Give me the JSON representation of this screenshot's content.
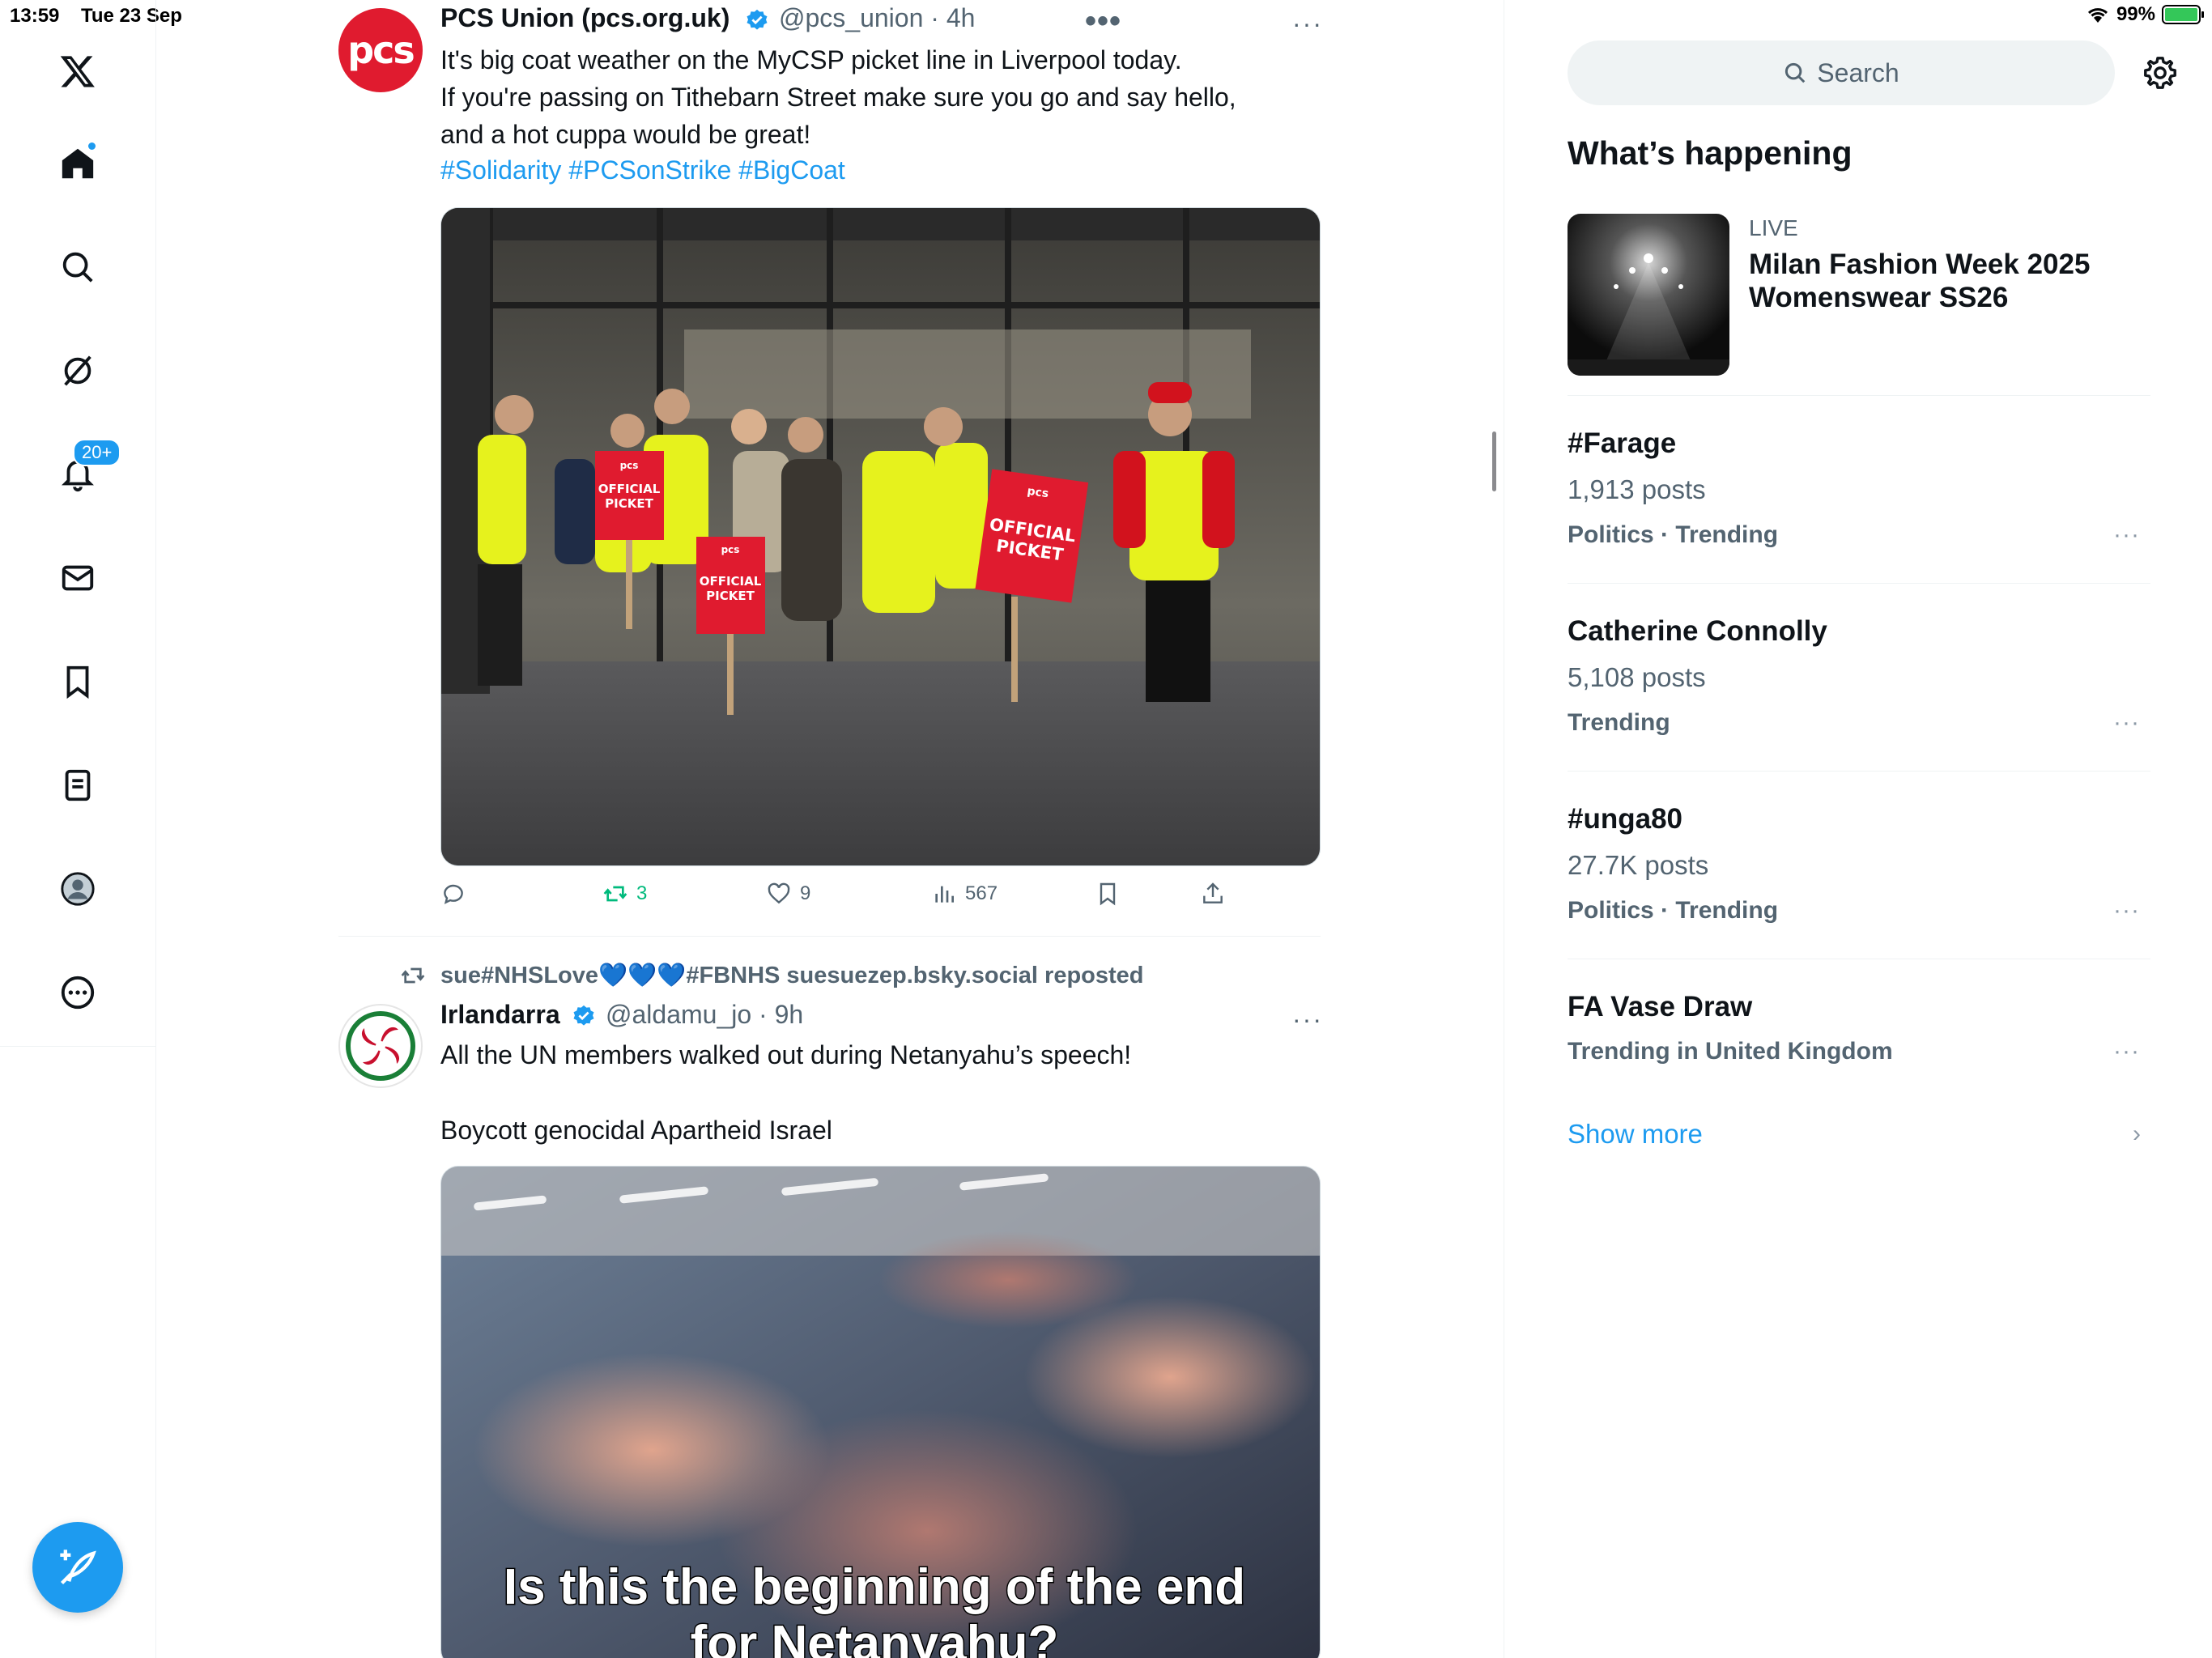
{
  "status_bar": {
    "time": "13:59",
    "date": "Tue 23 Sep",
    "battery": "99%"
  },
  "sidebar": {
    "notification_badge": "20+",
    "items": [
      "home",
      "explore",
      "grok",
      "notifications",
      "messages",
      "bookmarks",
      "lists",
      "profile",
      "more"
    ]
  },
  "feed": {
    "tweet1": {
      "name": "PCS Union (pcs.org.uk)",
      "avatar_text": "pcs",
      "handle_time": "@pcs_union · 4h",
      "line1": "It's big coat weather on the MyCSP picket line in Liverpool today.",
      "line2": "If you're passing on Tithebarn Street make sure you go and say hello,",
      "line3": "and a hot cuppa would be great!",
      "hashtags": "#Solidarity #PCSonStrike #BigCoat",
      "sign_text_1": "pcs",
      "sign_text_2": "OFFICIAL",
      "sign_text_3": "PICKET",
      "retweets": "3",
      "likes": "9",
      "views": "567"
    },
    "tweet2": {
      "repost_user_before": "sue#NHSLove",
      "repost_hearts": "💙💙💙",
      "repost_user_after": "#FBNHS suesuezep.bsky.social reposted",
      "name": "Irlandarra",
      "handle_time": "@aldamu_jo · 9h",
      "line1": "All the UN members walked out during Netanyahu’s speech!",
      "line2": "Boycott genocidal Apartheid Israel",
      "video_caption_1": "Is this the beginning of the end",
      "video_caption_2": "for Netanyahu?"
    }
  },
  "right": {
    "search_placeholder": "Search",
    "section_title": "What’s happening",
    "live": {
      "label": "LIVE",
      "title": "Milan Fashion Week 2025 Womenswear SS26"
    },
    "trends": [
      {
        "title": "#Farage",
        "count": "1,913 posts",
        "meta": "Politics · Trending"
      },
      {
        "title": "Catherine Connolly",
        "count": "5,108 posts",
        "meta": "Trending"
      },
      {
        "title": "#unga80",
        "count": "27.7K posts",
        "meta": "Politics · Trending"
      },
      {
        "title": "FA Vase Draw",
        "meta": "Trending in United Kingdom"
      }
    ],
    "show_more": "Show more"
  },
  "colors": {
    "accent": "#1d9bf0",
    "retweet": "#00ba7c",
    "pcs_red": "#e01b2f"
  }
}
